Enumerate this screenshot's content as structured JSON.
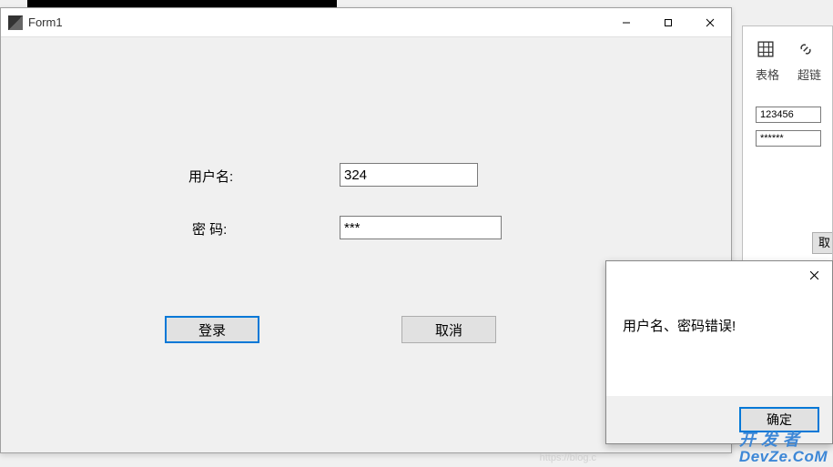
{
  "window": {
    "title": "Form1"
  },
  "form": {
    "username_label": "用户名:",
    "username_value": "324",
    "password_label": "密 码:",
    "password_value": "***",
    "login_button": "登录",
    "cancel_button": "取消"
  },
  "background_ribbon": {
    "table_label": "表格",
    "hyperlink_label": "超链",
    "field1_value": "123456",
    "field2_value": "******",
    "partial_button": "取"
  },
  "msgbox": {
    "message": "用户名、密码错误!",
    "ok_button": "确定"
  },
  "watermark": {
    "line1": "开 发 者",
    "line2": "DevZe.CoM"
  },
  "faint_url": "https://blog.c"
}
